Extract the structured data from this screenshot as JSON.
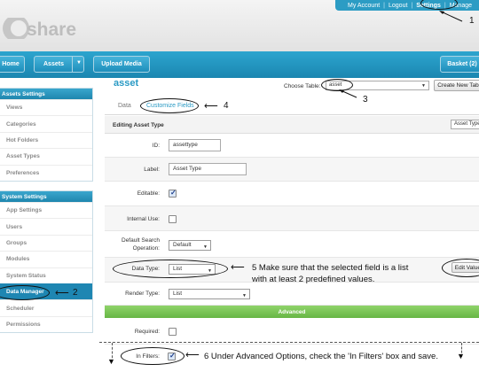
{
  "header": {
    "logo_text": "share",
    "toplinks": [
      "My Account",
      "Logout",
      "Settings",
      "Manage"
    ]
  },
  "nav": {
    "home": "Home",
    "assets": "Assets",
    "upload": "Upload Media",
    "basket": "Basket (2)"
  },
  "sidebar": {
    "assets_heading": "Assets Settings",
    "assets_items": [
      "Views",
      "Categories",
      "Hot Folders",
      "Asset Types",
      "Preferences"
    ],
    "system_heading": "System Settings",
    "system_items": [
      "App Settings",
      "Users",
      "Groups",
      "Modules",
      "System Status",
      "Data Manager",
      "Scheduler",
      "Permissions"
    ],
    "active_item": "Data Manager"
  },
  "main": {
    "title": "asset",
    "choose_table_label": "Choose Table:",
    "choose_table_value": "asset",
    "create_btn": "Create New Table",
    "tabs": [
      "Data",
      "Customize Fields"
    ],
    "editing_label": "Editing Asset Type",
    "editing_tag": "Asset Type",
    "fields": {
      "id_label": "ID:",
      "id_value": "assettype",
      "label_label": "Label:",
      "label_value": "Asset Type",
      "editable_label": "Editable:",
      "internal_label": "Internal Use:",
      "search_label_1": "Default Search",
      "search_label_2": "Operation:",
      "search_value": "Default",
      "datatype_label": "Data Type:",
      "datatype_value": "List",
      "edit_values_btn": "Edit Values",
      "render_label": "Render Type:",
      "render_value": "List",
      "advanced_heading": "Advanced",
      "required_label": "Required:",
      "infilters_label": "In Filters:"
    },
    "checks": {
      "editable": true,
      "internal": false,
      "required": false,
      "infilters": true
    }
  },
  "annotations": {
    "n1": "1",
    "n2": "2",
    "n3": "3",
    "n4": "4",
    "n5_line1": "5  Make sure that the selected field is a list",
    "n5_line2": "with at least 2 predefined values.",
    "n6": "6 Under Advanced Options, check the 'In Filters' box and save."
  }
}
